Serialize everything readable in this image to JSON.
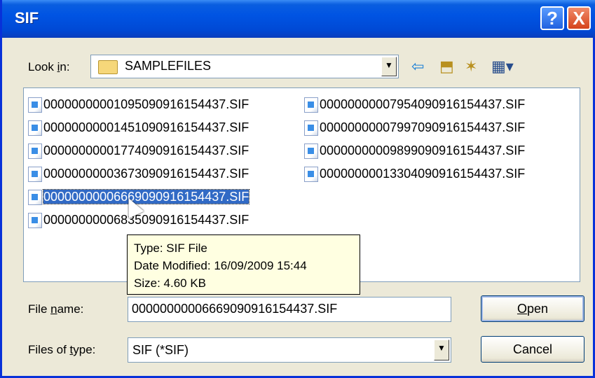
{
  "window": {
    "title": "SIF"
  },
  "title_buttons": {
    "help": "?",
    "close": "X"
  },
  "look_in": {
    "label_pre": "Look ",
    "label_u": "i",
    "label_post": "n:",
    "value": "SAMPLEFILES"
  },
  "toolbar": {
    "back_icon": "⇦",
    "up_icon": "⬒",
    "new_folder_icon": "✶",
    "view_icon": "▦▾"
  },
  "files": [
    "00000000001095090916154437.SIF",
    "00000000001451090916154437.SIF",
    "00000000001774090916154437.SIF",
    "00000000003673090916154437.SIF",
    "00000000006669090916154437.SIF",
    "00000000006835090916154437.SIF",
    "00000000007954090916154437.SIF",
    "00000000007997090916154437.SIF",
    "00000000009899090916154437.SIF",
    "00000000013304090916154437.SIF"
  ],
  "tooltip": {
    "type": "Type: SIF File",
    "modified": "Date Modified: 16/09/2009 15:44",
    "size": "Size: 4.60 KB"
  },
  "file_name": {
    "label_pre": "File ",
    "label_u": "n",
    "label_post": "ame:",
    "value": "00000000006669090916154437.SIF"
  },
  "file_type": {
    "label_pre": "Files of ",
    "label_u": "t",
    "label_post": "ype:",
    "value": "SIF (*SIF)"
  },
  "buttons": {
    "open_u": "O",
    "open_rest": "pen",
    "cancel": "Cancel"
  }
}
